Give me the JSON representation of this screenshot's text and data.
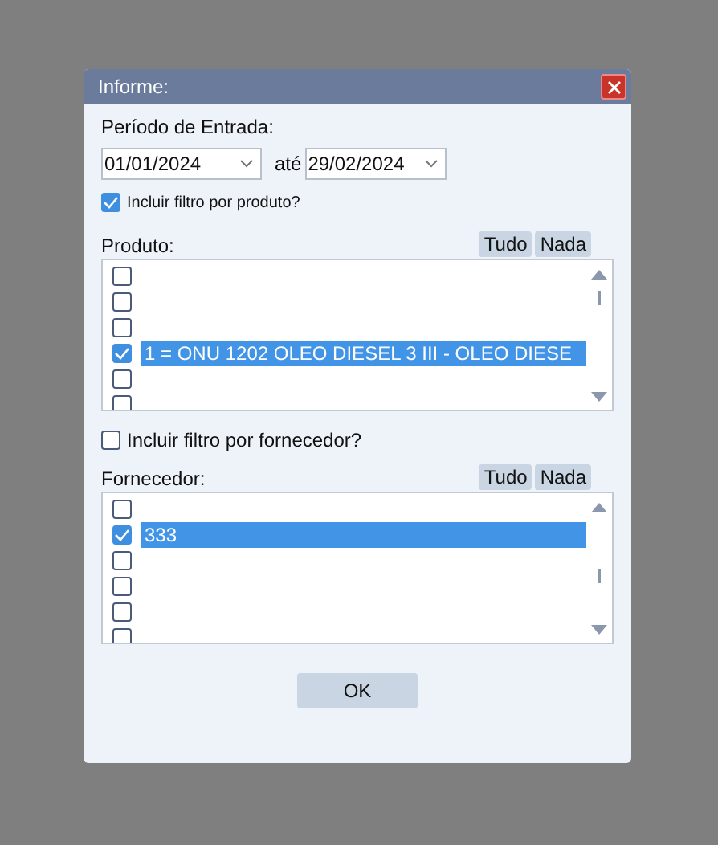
{
  "window": {
    "title": "Informe:"
  },
  "period": {
    "label": "Período de Entrada:",
    "from": "01/01/2024",
    "separator": "até",
    "to": "29/02/2024"
  },
  "product_filter": {
    "label": "Incluir filtro por produto?",
    "checked": true
  },
  "product_list": {
    "label": "Produto:",
    "buttons": [
      "Tudo",
      "Nada"
    ],
    "rows": [
      {
        "checked": false,
        "selected": false
      },
      {
        "checked": false,
        "selected": false
      },
      {
        "checked": false,
        "selected": false
      },
      {
        "checked": true,
        "selected": true,
        "text": "1 = ONU 1202 OLEO DIESEL 3 III - OLEO DIESE"
      },
      {
        "checked": false,
        "selected": false
      },
      {
        "checked": false,
        "selected": false
      }
    ]
  },
  "supplier_filter": {
    "label": "Incluir filtro por fornecedor?",
    "checked": false
  },
  "supplier_list": {
    "label": "Fornecedor:",
    "buttons": [
      "Tudo",
      "Nada"
    ],
    "rows": [
      {
        "checked": false,
        "selected": false
      },
      {
        "checked": true,
        "selected": true,
        "text": "333"
      },
      {
        "checked": false,
        "selected": false
      },
      {
        "checked": false,
        "selected": false
      },
      {
        "checked": false,
        "selected": false
      },
      {
        "checked": false,
        "selected": false
      }
    ]
  },
  "ok_button": "OK"
}
